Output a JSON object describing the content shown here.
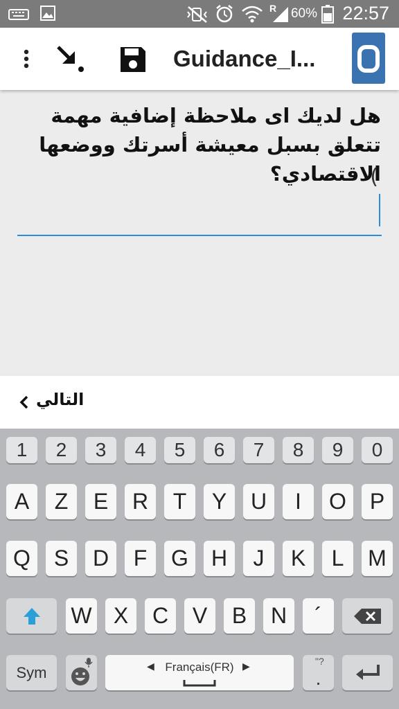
{
  "status_bar": {
    "battery_percent": "60%",
    "time": "22:57",
    "network_label": "R"
  },
  "toolbar": {
    "title": "Guidance_I..."
  },
  "form": {
    "question": "هل لديك اى ملاحظة إضافية مهمة تتعلق بسبل معيشة أسرتك ووضعها الاقتصادي؟",
    "answer_prefix": "(",
    "answer_value": ""
  },
  "navigation": {
    "next_label": "التالي"
  },
  "keyboard": {
    "number_row": [
      "1",
      "2",
      "3",
      "4",
      "5",
      "6",
      "7",
      "8",
      "9",
      "0"
    ],
    "row1": [
      "A",
      "Z",
      "E",
      "R",
      "T",
      "Y",
      "U",
      "I",
      "O",
      "P"
    ],
    "row2": [
      "Q",
      "S",
      "D",
      "F",
      "G",
      "H",
      "J",
      "K",
      "L",
      "M"
    ],
    "row3": [
      "W",
      "X",
      "C",
      "V",
      "B",
      "N",
      "´"
    ],
    "sym_label": "Sym",
    "language_label": "Français(FR)",
    "punct_label": ".",
    "punct_alt": "\"?"
  },
  "colors": {
    "accent": "#2a8ddb",
    "status_bar": "#7b7b7b",
    "app_icon": "#3b73b0"
  },
  "icons": [
    "keyboard-icon",
    "image-icon",
    "mute-icon",
    "alarm-icon",
    "wifi-icon",
    "signal-icon",
    "battery-icon",
    "more-vert-icon",
    "arrow-down-right-icon",
    "save-icon",
    "app-icon",
    "chevron-left-icon",
    "shift-icon",
    "backspace-icon",
    "emoji-icon",
    "microphone-icon",
    "enter-icon"
  ]
}
